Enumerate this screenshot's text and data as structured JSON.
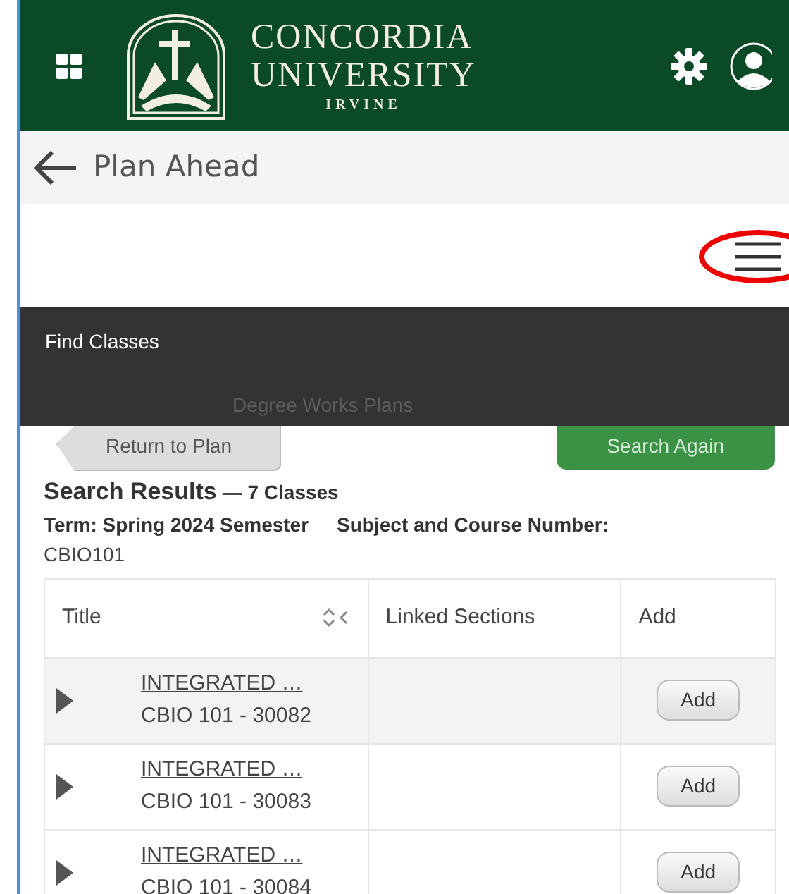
{
  "header": {
    "logo": {
      "line1": "CONCORDIA",
      "line2": "UNIVERSITY",
      "line3": "IRVINE"
    }
  },
  "page_title": "Plan Ahead",
  "menu": {
    "items": [
      {
        "label": "Find Classes",
        "selected": true
      },
      {
        "label": "Degree Works Plans",
        "selected": false
      }
    ]
  },
  "buttons": [
    {
      "label": "Return to Plan",
      "kind": "back"
    },
    {
      "label": "Search Again",
      "kind": "primary"
    }
  ],
  "results": {
    "heading": "Search Results",
    "count": "— 7 Classes",
    "term": "Term: Spring 2024 Semester",
    "subject_label": "Subject and Course Number:",
    "subject_value": "CBIO101"
  },
  "table": {
    "columns": [
      "Title",
      "Linked Sections",
      "Add"
    ],
    "rows": [
      {
        "title": "INTEGRATED …",
        "code": "CBIO 101 - 30082",
        "expanded": false,
        "add": "Add"
      },
      {
        "title": "INTEGRATED …",
        "code": "CBIO 101 - 30083",
        "expanded": false,
        "add": "Add"
      },
      {
        "title": "INTEGRATED …",
        "code": "CBIO 101 - 30084",
        "expanded": false,
        "add": "Add"
      }
    ]
  }
}
